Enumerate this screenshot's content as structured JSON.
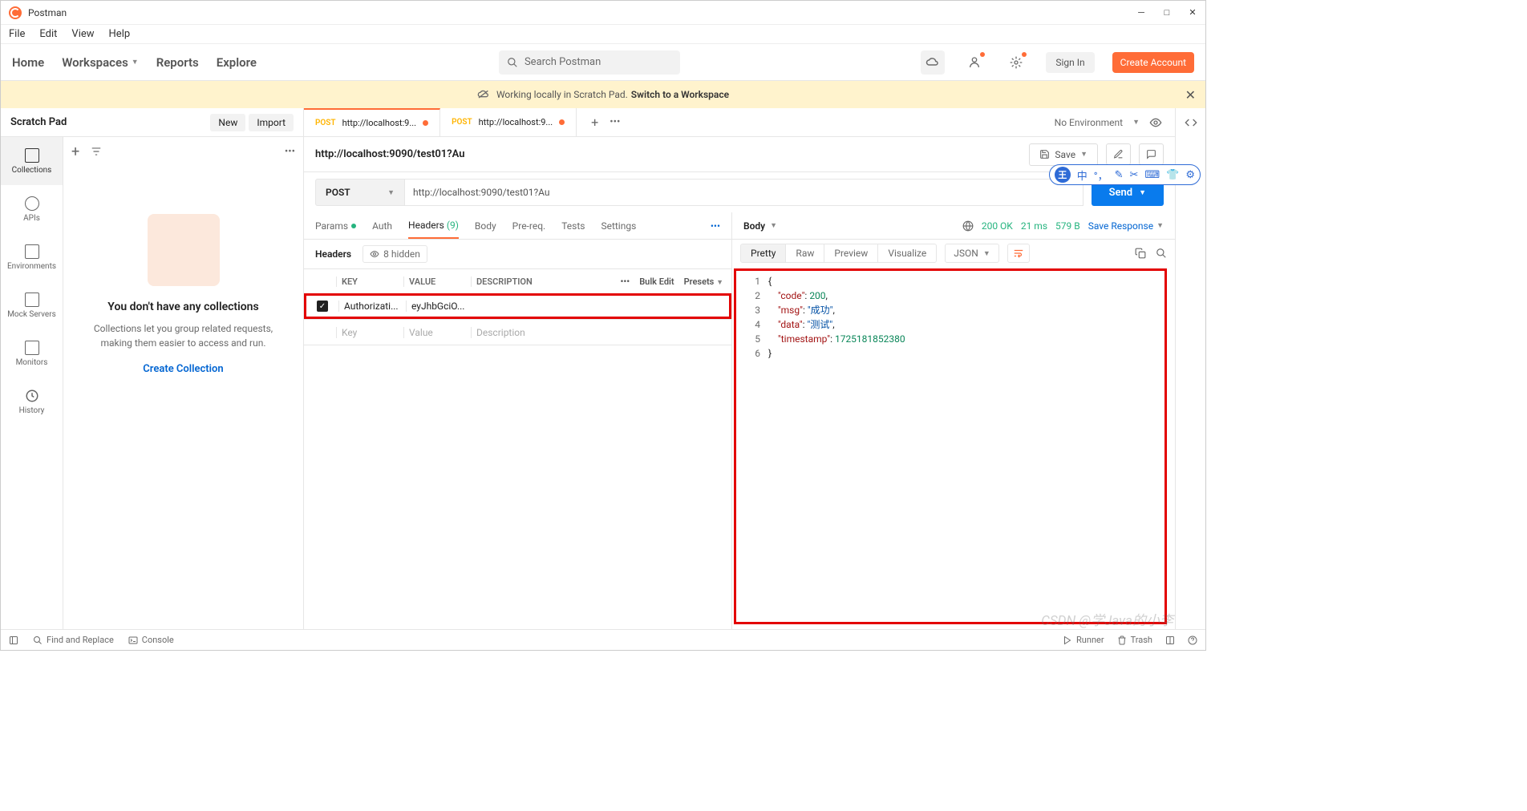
{
  "window": {
    "title": "Postman"
  },
  "menu": [
    "File",
    "Edit",
    "View",
    "Help"
  ],
  "nav": {
    "home": "Home",
    "workspaces": "Workspaces",
    "reports": "Reports",
    "explore": "Explore"
  },
  "search": {
    "placeholder": "Search Postman"
  },
  "auth": {
    "signin": "Sign In",
    "create": "Create Account"
  },
  "banner": {
    "text": "Working locally in Scratch Pad.",
    "cta": "Switch to a Workspace"
  },
  "scratch": {
    "title": "Scratch Pad",
    "new": "New",
    "import": "Import"
  },
  "sidebar": {
    "items": [
      {
        "label": "Collections"
      },
      {
        "label": "APIs"
      },
      {
        "label": "Environments"
      },
      {
        "label": "Mock Servers"
      },
      {
        "label": "Monitors"
      },
      {
        "label": "History"
      }
    ],
    "empty": {
      "title": "You don't have any collections",
      "desc": "Collections let you group related requests, making them easier to access and run.",
      "cta": "Create Collection"
    }
  },
  "tabs": [
    {
      "method": "POST",
      "label": "http://localhost:9...",
      "unsaved": true,
      "active": true
    },
    {
      "method": "POST",
      "label": "http://localhost:9...",
      "unsaved": true,
      "active": false
    }
  ],
  "env": {
    "label": "No Environment"
  },
  "request": {
    "name": "http://localhost:9090/test01?Au",
    "save": "Save",
    "method": "POST",
    "url": "http://localhost:9090/test01?Au",
    "send": "Send",
    "tabs": {
      "params": "Params",
      "auth": "Auth",
      "headers": "Headers",
      "headersCount": "(9)",
      "body": "Body",
      "prereq": "Pre-req.",
      "tests": "Tests",
      "settings": "Settings"
    },
    "headersBar": {
      "label": "Headers",
      "hidden": "8 hidden"
    },
    "table": {
      "head": {
        "key": "KEY",
        "value": "VALUE",
        "desc": "DESCRIPTION",
        "bulk": "Bulk Edit",
        "presets": "Presets"
      },
      "row": {
        "key": "Authorizati...",
        "value": "eyJhbGciO..."
      },
      "placeholder": {
        "key": "Key",
        "value": "Value",
        "desc": "Description"
      }
    }
  },
  "response": {
    "body": "Body",
    "status": "200 OK",
    "time": "21 ms",
    "size": "579 B",
    "save": "Save Response",
    "views": {
      "pretty": "Pretty",
      "raw": "Raw",
      "preview": "Preview",
      "visualize": "Visualize",
      "json": "JSON"
    },
    "json": {
      "lines": [
        "1",
        "2",
        "3",
        "4",
        "5",
        "6"
      ],
      "row1": "{",
      "row2": {
        "k": "\"code\"",
        "v": "200",
        "c": ","
      },
      "row3": {
        "k": "\"msg\"",
        "v": "\"成功\"",
        "c": ","
      },
      "row4": {
        "k": "\"data\"",
        "v": "\"测试\"",
        "c": ","
      },
      "row5": {
        "k": "\"timestamp\"",
        "v": "1725181852380"
      },
      "row6": "}"
    }
  },
  "statusbar": {
    "find": "Find and Replace",
    "console": "Console",
    "runner": "Runner",
    "trash": "Trash"
  },
  "watermark": "CSDN @学Java的小李",
  "floating": {
    "badge": "王",
    "zh": "中"
  }
}
